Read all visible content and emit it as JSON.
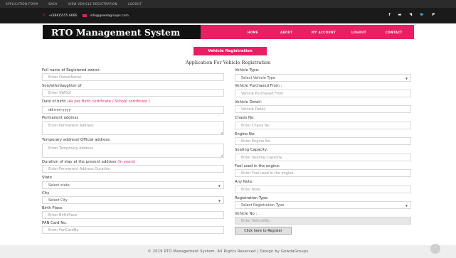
{
  "topnav": [
    "APPLICATION FORM",
    "BACK",
    "VIEW VEHICLE REGISTRATION",
    "LOGOUT"
  ],
  "contact": {
    "phone": "+(888)5555 6666",
    "email": "info@gowdagroups.com"
  },
  "social": [
    "f",
    "▬",
    "ॳ",
    "✦",
    "P"
  ],
  "brand": "RTO Management System",
  "menu": [
    "HOME",
    "ABOUT",
    "MY ACCOUNT",
    "LOGOUT",
    "CONTACT"
  ],
  "tag_button": "Vehicle Registration",
  "form_title": "Application For Vehicle Registration",
  "left": {
    "full_name": {
      "label": "Full name of Registered owner:",
      "placeholder": "Enter OwnerName"
    },
    "relation": {
      "label": "Son/wife/daughter of",
      "placeholder": "Enter SWDof"
    },
    "dob": {
      "label": "Date of birth",
      "hint": "(As per Birth certificate / School certificate )",
      "value": "dd-mm-yyyy"
    },
    "permanent": {
      "label": "Permanent address",
      "placeholder": "Enter Permanent Address"
    },
    "temporary": {
      "label": "Temporary address/ Official address:",
      "placeholder": "Enter Temporary Address"
    },
    "duration": {
      "label": "Duration of stay at the present address",
      "hint": "(In years)",
      "placeholder": "Enter Permanent Address Duration"
    },
    "state": {
      "label": "State",
      "selected": "Select state"
    },
    "city": {
      "label": "City",
      "selected": "Select City"
    },
    "birth_place": {
      "label": "Birth Place",
      "placeholder": "Enter BirthPlace"
    },
    "pan": {
      "label": "PAN Card No.",
      "placeholder": "Enter PanCardNo"
    }
  },
  "right": {
    "vehicle_type": {
      "label": "Vehicle Type:",
      "selected": "Select Vehicle Type"
    },
    "purchased_from": {
      "label": "Vehicle Purchased From :",
      "placeholder": "Vehicle Purchased From"
    },
    "vehicle_detail": {
      "label": "Vehicle Detail:",
      "placeholder": "Vehicle Detail"
    },
    "chasis": {
      "label": "Chasis No:",
      "placeholder": "Enter Chasis No"
    },
    "engine": {
      "label": "Engine No:",
      "placeholder": "Enter Engine No"
    },
    "seating": {
      "label": "Seating Capacity:",
      "placeholder": "Enter Seating Capacity"
    },
    "fuel": {
      "label": "Fuel used in the engine:",
      "placeholder": "Enter Fuel used in the engine"
    },
    "note": {
      "label": "Any Note:",
      "placeholder": "Enter Note"
    },
    "reg_type": {
      "label": "Registration Type:",
      "selected": "Select Registration Type"
    },
    "vehicle_no": {
      "label": "Vehicle No :",
      "placeholder": "Enter VehicleNo"
    }
  },
  "register_button": "Click here to Register",
  "footer": "© 2019 RTO Management System. All Rights Reserved | Design by GowdaGroups",
  "colors": {
    "accent": "#e91e63",
    "dark": "#111111",
    "topbar": "#2b2b2b"
  },
  "icons": {
    "back_to_top": "chevron-up-icon",
    "dropdown": "caret-down-icon"
  }
}
